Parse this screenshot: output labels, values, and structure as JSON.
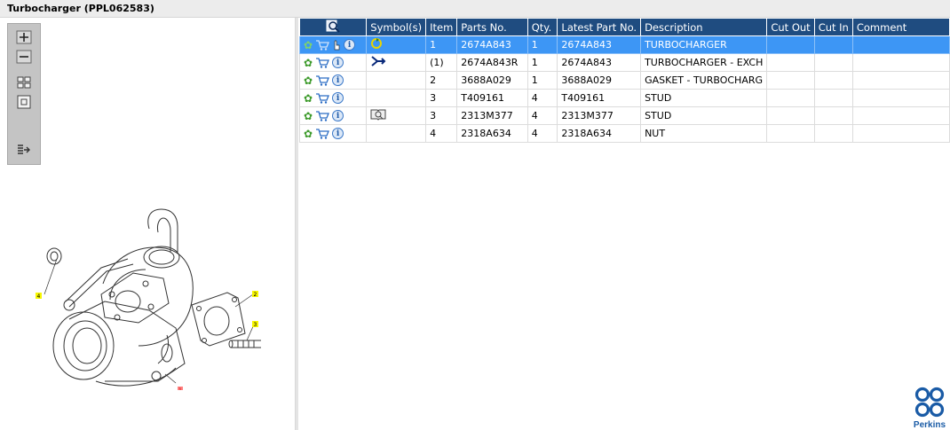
{
  "window": {
    "title": "Turbocharger (PPL062583)"
  },
  "toolbar": {
    "buttons": [
      {
        "name": "zoom-in-button",
        "icon": "plus-icon"
      },
      {
        "name": "zoom-out-button",
        "icon": "minus-icon"
      },
      {
        "name": "fit-all-button",
        "icon": "grid-icon"
      },
      {
        "name": "fit-window-button",
        "icon": "square-icon"
      },
      {
        "name": "export-button",
        "icon": "list-arrow-icon"
      }
    ]
  },
  "diagram": {
    "callouts": [
      "4",
      "2",
      "3",
      "1"
    ],
    "colors": {
      "callout": "#f7f700",
      "callout_selected": "#ff8080"
    }
  },
  "table": {
    "columns": [
      "",
      "Symbol(s)",
      "Item",
      "Parts No.",
      "Qty.",
      "Latest Part No.",
      "Description",
      "Cut Out",
      "Cut In",
      "Comment"
    ],
    "rows": [
      {
        "item": "1",
        "parts_no": "2674A843",
        "qty": "1",
        "latest": "2674A843",
        "description": "TURBOCHARGER",
        "cut_out": "",
        "cut_in": "",
        "comment": "",
        "selected": true,
        "symbol": "recycle-icon"
      },
      {
        "item": "(1)",
        "parts_no": "2674A843R",
        "qty": "1",
        "latest": "2674A843",
        "description": "TURBOCHARGER - EXCH",
        "cut_out": "",
        "cut_in": "",
        "comment": "",
        "selected": false,
        "symbol": "exchange-icon"
      },
      {
        "item": "2",
        "parts_no": "3688A029",
        "qty": "1",
        "latest": "3688A029",
        "description": "GASKET - TURBOCHARG",
        "cut_out": "",
        "cut_in": "",
        "comment": "",
        "selected": false,
        "symbol": ""
      },
      {
        "item": "3",
        "parts_no": "T409161",
        "qty": "4",
        "latest": "T409161",
        "description": "STUD",
        "cut_out": "",
        "cut_in": "",
        "comment": "",
        "selected": false,
        "symbol": ""
      },
      {
        "item": "3",
        "parts_no": "2313M377",
        "qty": "4",
        "latest": "2313M377",
        "description": "STUD",
        "cut_out": "",
        "cut_in": "",
        "comment": "",
        "selected": false,
        "symbol": "book-icon"
      },
      {
        "item": "4",
        "parts_no": "2318A634",
        "qty": "4",
        "latest": "2318A634",
        "description": "NUT",
        "cut_out": "",
        "cut_in": "",
        "comment": "",
        "selected": false,
        "symbol": ""
      }
    ]
  },
  "colors": {
    "header_bg": "#1f4c80",
    "selected_row": "#3d96f5",
    "logo_blue": "#1a5ba6"
  },
  "logo": {
    "text": "Perkins"
  }
}
